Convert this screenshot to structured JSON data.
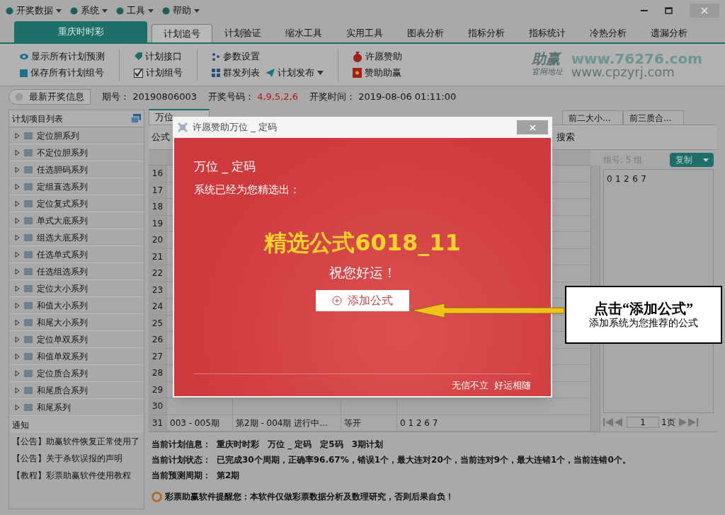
{
  "menu": [
    {
      "label": "开奖数据"
    },
    {
      "label": "系统"
    },
    {
      "label": "工具"
    },
    {
      "label": "帮助"
    }
  ],
  "app_tab": {
    "label": "重庆时时彩"
  },
  "tabs": [
    {
      "label": "计划追号",
      "selected": true
    },
    {
      "label": "计划验证",
      "selected": false
    },
    {
      "label": "缩水工具",
      "selected": false
    },
    {
      "label": "实用工具",
      "selected": false
    },
    {
      "label": "图表分析",
      "selected": false
    },
    {
      "label": "指标分析",
      "selected": false
    },
    {
      "label": "指标统计",
      "selected": false
    },
    {
      "label": "冷热分析",
      "selected": false
    },
    {
      "label": "遗漏分析",
      "selected": false
    }
  ],
  "toolbar_groups": [
    [
      {
        "label": "显示所有计划预测"
      },
      {
        "label": "保存所有计划组号"
      }
    ],
    [
      {
        "label": "计划接口"
      },
      {
        "label": "计划组号",
        "kind": "checkbox",
        "checked": true
      }
    ],
    [
      {
        "label": "参数设置"
      },
      {
        "label": "群发列表"
      },
      {
        "label": "计划发布",
        "dropdown": true
      }
    ],
    [
      {
        "label": "许愿赞助"
      },
      {
        "label": "赞助助赢"
      }
    ]
  ],
  "brand": {
    "name": "助赢",
    "url": "www.76276.com",
    "caption": "官网地址",
    "url2": "www.cpzyrj.com"
  },
  "draw_info": {
    "button": "最新开奖信息",
    "period_label": "期号：",
    "period": "20190806003",
    "numbers_label": "开奖号码：",
    "numbers": "4,9,5,2,6",
    "time_label": "开奖时间：",
    "time": "2019-08-06 01:11:00"
  },
  "sidebar": {
    "title": "计划项目列表",
    "items": [
      {
        "label": "定位胆系列",
        "expanded": false
      },
      {
        "label": "不定位胆系列",
        "expanded": false
      },
      {
        "label": "任选胆码系列",
        "expanded": false
      },
      {
        "label": "定组直选系列",
        "expanded": false
      },
      {
        "label": "定位复式系列",
        "expanded": false
      },
      {
        "label": "单式大底系列",
        "expanded": false
      },
      {
        "label": "组选大底系列",
        "expanded": false
      },
      {
        "label": "任选单式系列",
        "expanded": false
      },
      {
        "label": "任选组选系列",
        "expanded": false
      },
      {
        "label": "定位大小系列",
        "expanded": false
      },
      {
        "label": "和值大小系列",
        "expanded": false
      },
      {
        "label": "和尾大小系列",
        "expanded": false
      },
      {
        "label": "定位单双系列",
        "expanded": false
      },
      {
        "label": "和值单双系列",
        "expanded": false
      },
      {
        "label": "定位质合系列",
        "expanded": false
      },
      {
        "label": "和尾质合系列",
        "expanded": false
      },
      {
        "label": "和尾系列",
        "expanded": false
      }
    ],
    "notice_title": "通知",
    "notices": [
      "【公告】助赢软件恢复正常使用了",
      "【公告】关于杀软误报的声明",
      "【教程】彩票助赢软件使用教程"
    ]
  },
  "content_tabs": [
    {
      "label": "万位",
      "selected": true
    },
    {
      "label": "前二大小...",
      "selected": false
    },
    {
      "label": "前三质合...",
      "selected": false
    }
  ],
  "filter": {
    "label": "公式",
    "search": "搜索"
  },
  "table": {
    "rows": [
      {
        "num": "16"
      },
      {
        "num": "17"
      },
      {
        "num": "18"
      },
      {
        "num": "19"
      },
      {
        "num": "20"
      },
      {
        "num": "21"
      },
      {
        "num": "22"
      },
      {
        "num": "23"
      },
      {
        "num": "24"
      },
      {
        "num": "25"
      },
      {
        "num": "26"
      },
      {
        "num": "27"
      },
      {
        "num": "28"
      },
      {
        "num": "29"
      },
      {
        "num": "30"
      },
      {
        "num": "31",
        "cells": [
          "003 - 005期",
          "第2期 - 004期 进行中...",
          "等开",
          "0 1 2 6 7"
        ]
      }
    ]
  },
  "group_panel": {
    "count": "组号: 5 组",
    "copy": "复制",
    "text": "0 1 2 6 7",
    "page": "1",
    "pages": "1页"
  },
  "plan_info": [
    {
      "label": "当前计划信息：",
      "value": "重庆时时彩　万位 _ 定码　定5码　3期计划"
    },
    {
      "label": "当前计划状态：",
      "value": "已完成30个周期，正确率96.67%，错误1个，最大连对20个，当前连对9个，最大连错1个，当前连错0个。"
    },
    {
      "label": "当前预测周期：",
      "value": "第2期"
    }
  ],
  "warning": "彩票助赢软件提醒您：本软件仅做彩票数据分析及数理研究，否则后果自负！",
  "dialog": {
    "title": "许愿赞助万位 _ 定码",
    "heading": "万位 _ 定码",
    "subheading": "系统已经为您精选出：",
    "formula": "精选公式6018_11",
    "wish": "祝您好运！",
    "button": "添加公式",
    "footer": [
      "无信不立",
      "好运相随"
    ]
  },
  "callout": {
    "title": "点击“添加公式”",
    "text": "添加系统为您推荐的公式"
  }
}
